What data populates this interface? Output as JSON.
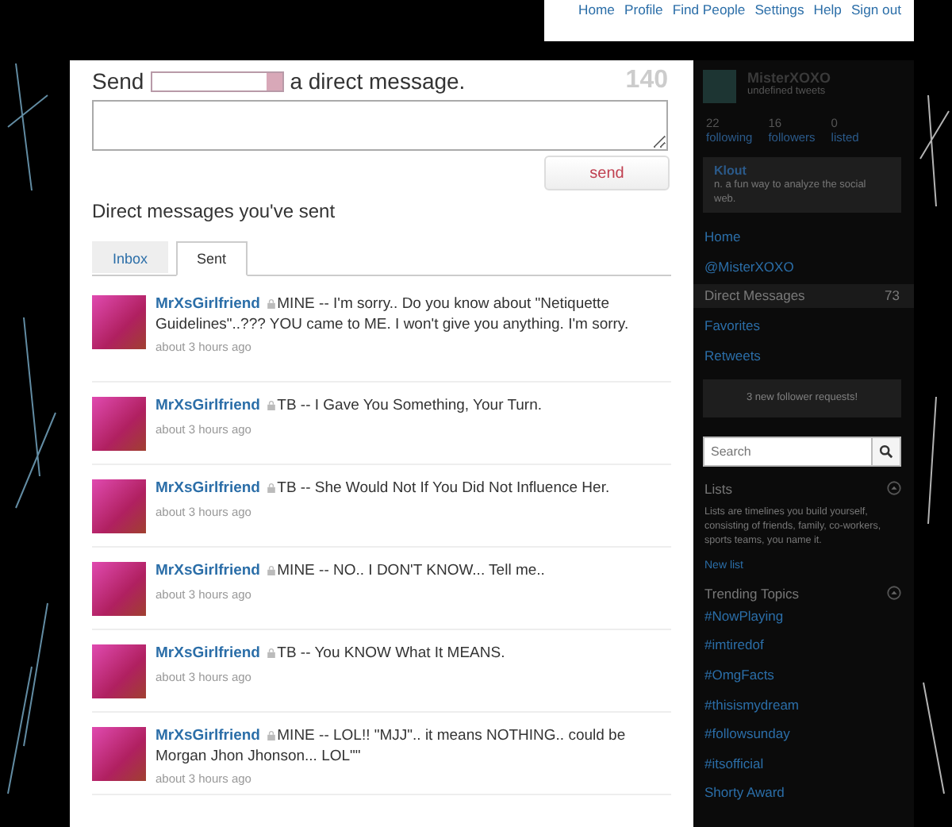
{
  "top_nav": [
    "Home",
    "Profile",
    "Find People",
    "Settings",
    "Help",
    "Sign out"
  ],
  "compose": {
    "label_before": "Send",
    "label_after": "a direct message.",
    "counter": "140",
    "button": "send"
  },
  "heading": "Direct messages you've sent",
  "tabs": [
    {
      "label": "Inbox",
      "selected": false
    },
    {
      "label": "Sent",
      "selected": true
    }
  ],
  "messages": [
    {
      "sender": "MrXsGirlfriend",
      "locked": true,
      "text": "MINE -- I'm sorry.. Do you know about \"Netiquette Guidelines\"..??? YOU came to ME. I won't give you anything. I'm sorry.",
      "time": "about 3 hours ago"
    },
    {
      "sender": "MrXsGirlfriend",
      "locked": true,
      "text": "TB -- I Gave You Something, Your Turn.",
      "time": "about 3 hours ago"
    },
    {
      "sender": "MrXsGirlfriend",
      "locked": true,
      "text": "TB -- She Would Not If You Did Not Influence Her.",
      "time": "about 3 hours ago"
    },
    {
      "sender": "MrXsGirlfriend",
      "locked": true,
      "text": "MINE -- NO.. I DON'T KNOW... Tell me..",
      "time": "about 3 hours ago"
    },
    {
      "sender": "MrXsGirlfriend",
      "locked": true,
      "text": "TB -- You KNOW What It MEANS.",
      "time": "about 3 hours ago"
    },
    {
      "sender": "MrXsGirlfriend",
      "locked": true,
      "text": "MINE -- LOL!! \"MJJ\".. it means NOTHING.. could be Morgan Jhon Jhonson... LOL\"\"",
      "time": "about 3 hours ago"
    }
  ],
  "sidebar": {
    "profile": {
      "name": "MisterXOXO",
      "tweets": "undefined tweets"
    },
    "stats": [
      {
        "value": "22",
        "label": "following"
      },
      {
        "value": "16",
        "label": "followers"
      },
      {
        "value": "0",
        "label": "listed"
      }
    ],
    "klout": {
      "title": "Klout",
      "text": "n. a fun way to analyze the social web."
    },
    "nav": [
      {
        "label": "Home",
        "selected": false
      },
      {
        "label": "@MisterXOXO",
        "selected": false
      },
      {
        "label": "Direct Messages",
        "selected": true,
        "count": "73"
      },
      {
        "label": "Favorites",
        "selected": false
      },
      {
        "label": "Retweets",
        "selected": false
      }
    ],
    "follower_requests": "3 new follower requests!",
    "search": {
      "placeholder": "Search"
    },
    "lists": {
      "title": "Lists",
      "text": "Lists are timelines you build yourself, consisting of friends, family, co-workers, sports teams, you name it.",
      "link": "New list"
    },
    "trending": {
      "title": "Trending Topics",
      "items": [
        "#NowPlaying",
        "#imtiredof",
        "#OmgFacts",
        "#thisismydream",
        "#followsunday",
        "#itsofficial",
        "Shorty Award"
      ]
    }
  }
}
